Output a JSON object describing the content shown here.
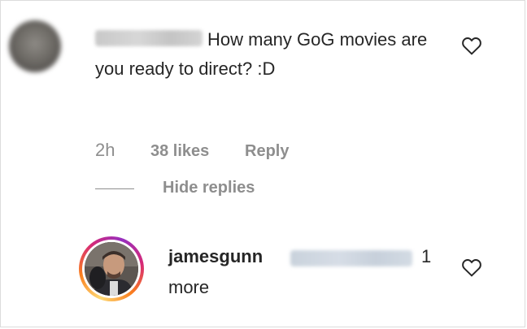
{
  "comment": {
    "text": "How many GoG movies are you ready to direct? :D",
    "time": "2h",
    "likes": "38 likes",
    "reply_label": "Reply",
    "hide_replies_label": "Hide replies"
  },
  "reply": {
    "username": "jamesgunn",
    "text_end": "1",
    "text_line2": "more"
  },
  "icons": {
    "like": "heart-outline-icon"
  },
  "colors": {
    "text": "#262626",
    "muted": "#8e8e8e",
    "story_ring": [
      "#feda75",
      "#fa7e1e",
      "#d62976",
      "#962fbf"
    ]
  }
}
